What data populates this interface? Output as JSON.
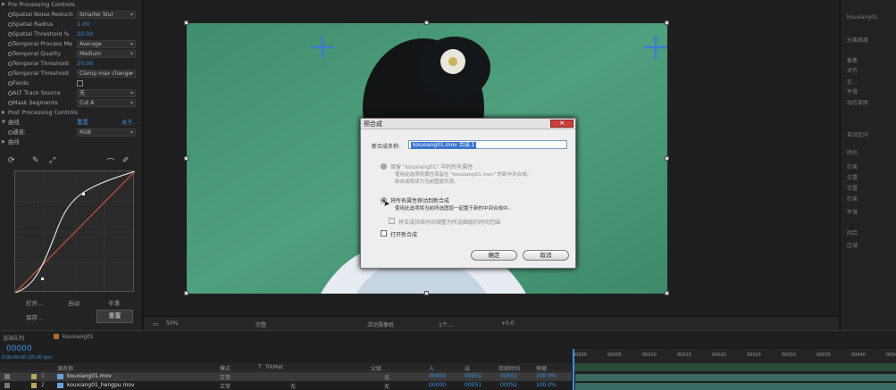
{
  "effect_panel": {
    "rows": [
      {
        "kind": "section",
        "label": "Pre Processing Controls"
      },
      {
        "kind": "dropdown",
        "label": "Spatial Noise Reducti",
        "value": "Smarter blur"
      },
      {
        "kind": "value",
        "label": "Spatial Radius",
        "value": "1.00"
      },
      {
        "kind": "value",
        "label": "Spatial Threshold %",
        "value": "20.00"
      },
      {
        "kind": "dropdown",
        "label": "Temporal Process Me",
        "value": "Average"
      },
      {
        "kind": "dropdown",
        "label": "Temporal Quality",
        "value": "Medium"
      },
      {
        "kind": "value",
        "label": "Temporal Threshold",
        "value": "20.00"
      },
      {
        "kind": "dropdown",
        "label": "Temporal Threshold",
        "value": "Clamp max change"
      },
      {
        "kind": "check",
        "label": "Fields",
        "value": ""
      },
      {
        "kind": "dropdown",
        "label": "ALT Track Source",
        "value": "无"
      },
      {
        "kind": "dropdown",
        "label": "Mask Segments",
        "value": "Cut A"
      },
      {
        "kind": "section",
        "label": "Post Processing Controls"
      },
      {
        "kind": "fx",
        "label": "曲线",
        "value": "重置",
        "extra": "关于..."
      },
      {
        "kind": "dropdown",
        "label": "通道:",
        "value": "RGB"
      },
      {
        "kind": "section",
        "label": "曲线"
      }
    ],
    "curve_buttons": [
      "打开...",
      "自动",
      "平滑",
      "保存...",
      "重置"
    ]
  },
  "dialog": {
    "title": "预合成",
    "name_label": "新合成名称:",
    "name_value": "kouxiang01.mov 合成 1",
    "option1_title": "保留 \"kouxiang01\" 中的所有属性",
    "option1_desc1": "使用此选项将属性保留在 \"kouxiang01.mov\" 的新中间合成。",
    "option1_desc2": "新合成将成为当前图层的源。",
    "option2_title": "将所有属性移动到新合成",
    "option2_desc": "使用此选项将当前所选图层一起置于新的中间合成中。",
    "adjust_label": "将合成持续时间调整为所选图层的时间范围",
    "open_label": "打开新合成",
    "ok_label": "确定",
    "cancel_label": "取消",
    "close_label": "✕"
  },
  "viewer_bar": {
    "zoom": "50%",
    "res": "完整",
    "camera": "活动摄像机",
    "views": "1个...",
    "exposure": "+0.0"
  },
  "right_panel": {
    "items": [
      "kouxiang01",
      "分离维度",
      "像素",
      "对齐",
      "在...",
      "平滑",
      "动态草图",
      "自动定向",
      "时间",
      "约束",
      "位置",
      "位置",
      "约束",
      "平滑",
      "闭合",
      "区域"
    ]
  },
  "timeline": {
    "tab1": "渲染队列",
    "tab2": "kouxiang01",
    "timecode": "00000",
    "fps": "0:00:00:00 (25.00 fps)",
    "col_source": "源名称",
    "col_mode": "模式",
    "col_t": "T",
    "col_trkmat": "TrkMat",
    "col_parent": "父级",
    "col_in": "入",
    "col_out": "出",
    "col_duration": "持续时间",
    "col_stretch": "伸缩",
    "rows": [
      {
        "num": "1",
        "name": "kouxiang01.mov",
        "mode": "正常",
        "trk": "",
        "parent": "无",
        "in": "00000",
        "out": "00051",
        "dur": "00052",
        "stretch": "100.0%"
      },
      {
        "num": "2",
        "name": "kouxiang01_hengpu.mov",
        "mode": "正常",
        "trk": "无",
        "parent": "无",
        "in": "00000",
        "out": "00051",
        "dur": "00052",
        "stretch": "100.0%"
      }
    ],
    "ruler": [
      "00000",
      "00005",
      "00010",
      "00015",
      "00020",
      "00025",
      "00030",
      "00035",
      "00040",
      "00045"
    ]
  }
}
